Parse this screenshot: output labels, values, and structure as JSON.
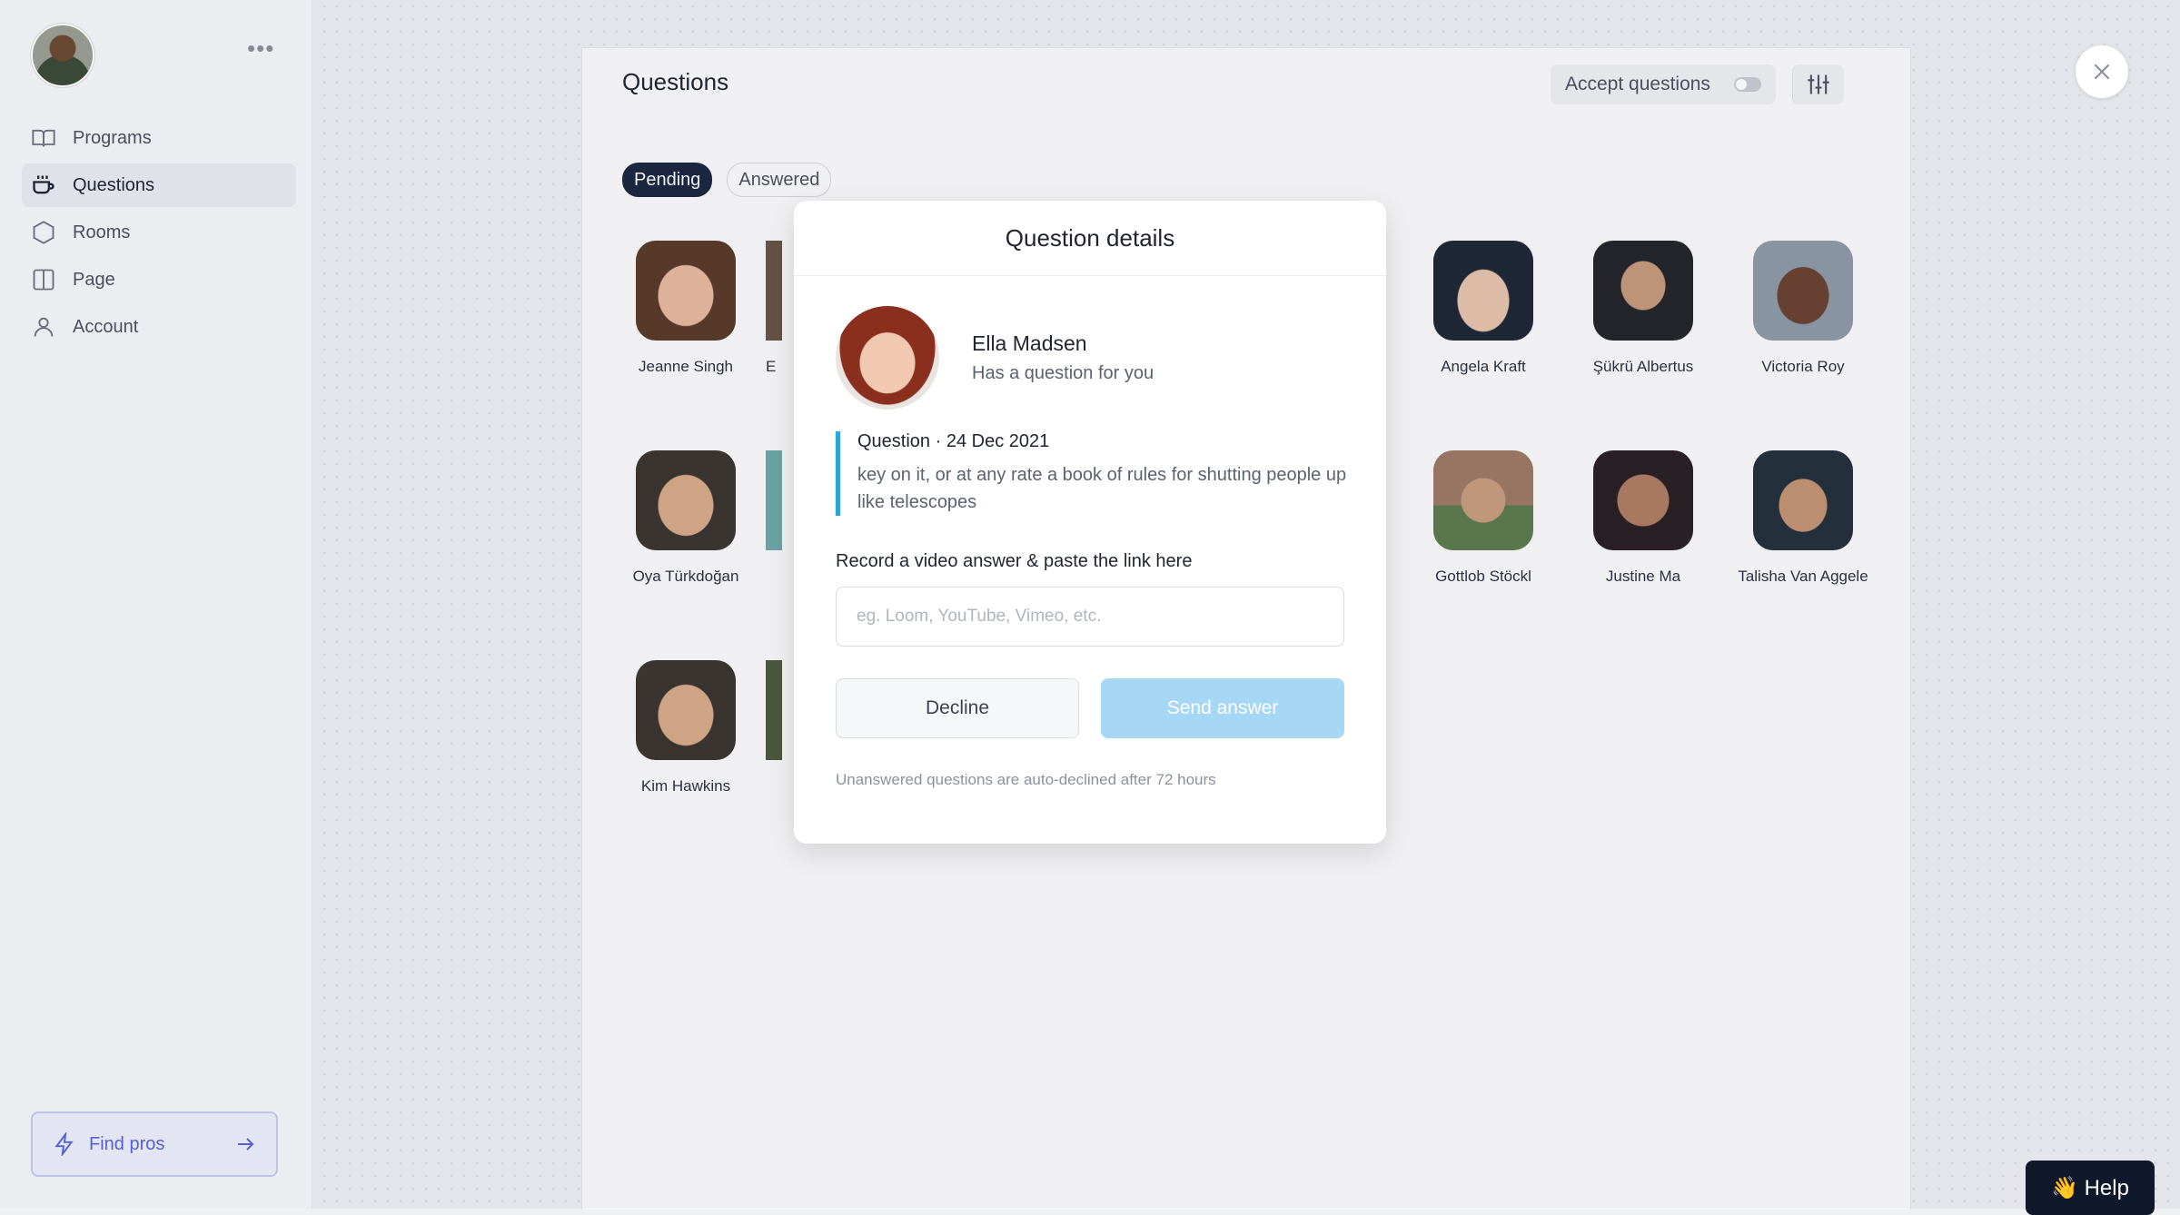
{
  "sidebar": {
    "items": [
      {
        "label": "Programs",
        "icon": "book-icon"
      },
      {
        "label": "Questions",
        "icon": "cup-icon"
      },
      {
        "label": "Rooms",
        "icon": "hexagon-icon"
      },
      {
        "label": "Page",
        "icon": "columns-icon"
      },
      {
        "label": "Account",
        "icon": "user-icon"
      }
    ],
    "find_pros": "Find pros"
  },
  "main": {
    "title": "Questions",
    "accept_label": "Accept questions",
    "tabs": [
      "Pending",
      "Answered"
    ],
    "people": [
      {
        "name": "Jeanne Singh"
      },
      {
        "name": "E"
      },
      {
        "name": "Angela Kraft"
      },
      {
        "name": "Şükrü Albertus"
      },
      {
        "name": "Victoria Roy"
      },
      {
        "name": "Oya Türkdoğan"
      },
      {
        "name": "Gottlob Stöckl"
      },
      {
        "name": "Justine Ma"
      },
      {
        "name": "Talisha Van Aggele"
      },
      {
        "name": "Kim Hawkins"
      }
    ]
  },
  "modal": {
    "title": "Question details",
    "asker_name": "Ella Madsen",
    "asker_sub": "Has a question for you",
    "question_head": "Question · 24 Dec 2021",
    "question_text": "key on it, or at any rate a book of rules for shutting people up like telescopes",
    "record_label": "Record a video answer & paste the link here",
    "link_placeholder": "eg. Loom, YouTube, Vimeo, etc.",
    "decline_label": "Decline",
    "send_label": "Send answer",
    "footnote": "Unanswered questions are auto-declined after 72 hours"
  },
  "help_label": "👋 Help",
  "colors": {
    "accent": "#2aa6de",
    "send_disabled": "#a6d8f6",
    "tab_active": "#1b2642"
  }
}
